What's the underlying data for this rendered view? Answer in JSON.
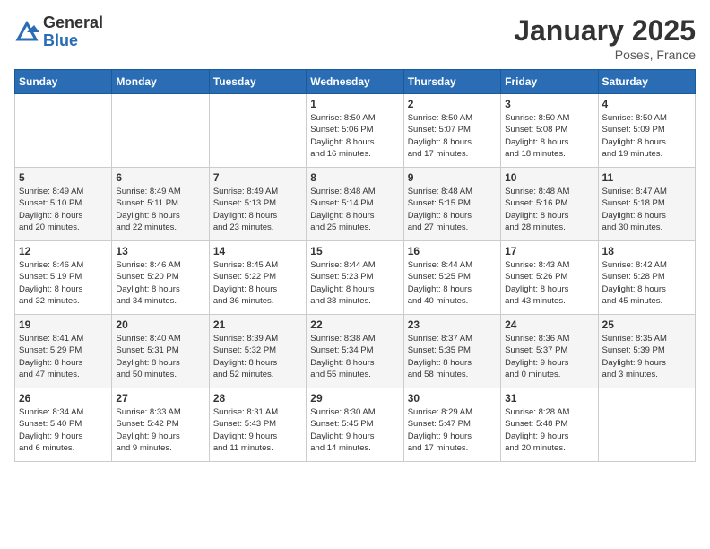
{
  "header": {
    "logo_general": "General",
    "logo_blue": "Blue",
    "month_title": "January 2025",
    "location": "Poses, France"
  },
  "days_of_week": [
    "Sunday",
    "Monday",
    "Tuesday",
    "Wednesday",
    "Thursday",
    "Friday",
    "Saturday"
  ],
  "weeks": [
    [
      {
        "day": "",
        "content": ""
      },
      {
        "day": "",
        "content": ""
      },
      {
        "day": "",
        "content": ""
      },
      {
        "day": "1",
        "content": "Sunrise: 8:50 AM\nSunset: 5:06 PM\nDaylight: 8 hours\nand 16 minutes."
      },
      {
        "day": "2",
        "content": "Sunrise: 8:50 AM\nSunset: 5:07 PM\nDaylight: 8 hours\nand 17 minutes."
      },
      {
        "day": "3",
        "content": "Sunrise: 8:50 AM\nSunset: 5:08 PM\nDaylight: 8 hours\nand 18 minutes."
      },
      {
        "day": "4",
        "content": "Sunrise: 8:50 AM\nSunset: 5:09 PM\nDaylight: 8 hours\nand 19 minutes."
      }
    ],
    [
      {
        "day": "5",
        "content": "Sunrise: 8:49 AM\nSunset: 5:10 PM\nDaylight: 8 hours\nand 20 minutes."
      },
      {
        "day": "6",
        "content": "Sunrise: 8:49 AM\nSunset: 5:11 PM\nDaylight: 8 hours\nand 22 minutes."
      },
      {
        "day": "7",
        "content": "Sunrise: 8:49 AM\nSunset: 5:13 PM\nDaylight: 8 hours\nand 23 minutes."
      },
      {
        "day": "8",
        "content": "Sunrise: 8:48 AM\nSunset: 5:14 PM\nDaylight: 8 hours\nand 25 minutes."
      },
      {
        "day": "9",
        "content": "Sunrise: 8:48 AM\nSunset: 5:15 PM\nDaylight: 8 hours\nand 27 minutes."
      },
      {
        "day": "10",
        "content": "Sunrise: 8:48 AM\nSunset: 5:16 PM\nDaylight: 8 hours\nand 28 minutes."
      },
      {
        "day": "11",
        "content": "Sunrise: 8:47 AM\nSunset: 5:18 PM\nDaylight: 8 hours\nand 30 minutes."
      }
    ],
    [
      {
        "day": "12",
        "content": "Sunrise: 8:46 AM\nSunset: 5:19 PM\nDaylight: 8 hours\nand 32 minutes."
      },
      {
        "day": "13",
        "content": "Sunrise: 8:46 AM\nSunset: 5:20 PM\nDaylight: 8 hours\nand 34 minutes."
      },
      {
        "day": "14",
        "content": "Sunrise: 8:45 AM\nSunset: 5:22 PM\nDaylight: 8 hours\nand 36 minutes."
      },
      {
        "day": "15",
        "content": "Sunrise: 8:44 AM\nSunset: 5:23 PM\nDaylight: 8 hours\nand 38 minutes."
      },
      {
        "day": "16",
        "content": "Sunrise: 8:44 AM\nSunset: 5:25 PM\nDaylight: 8 hours\nand 40 minutes."
      },
      {
        "day": "17",
        "content": "Sunrise: 8:43 AM\nSunset: 5:26 PM\nDaylight: 8 hours\nand 43 minutes."
      },
      {
        "day": "18",
        "content": "Sunrise: 8:42 AM\nSunset: 5:28 PM\nDaylight: 8 hours\nand 45 minutes."
      }
    ],
    [
      {
        "day": "19",
        "content": "Sunrise: 8:41 AM\nSunset: 5:29 PM\nDaylight: 8 hours\nand 47 minutes."
      },
      {
        "day": "20",
        "content": "Sunrise: 8:40 AM\nSunset: 5:31 PM\nDaylight: 8 hours\nand 50 minutes."
      },
      {
        "day": "21",
        "content": "Sunrise: 8:39 AM\nSunset: 5:32 PM\nDaylight: 8 hours\nand 52 minutes."
      },
      {
        "day": "22",
        "content": "Sunrise: 8:38 AM\nSunset: 5:34 PM\nDaylight: 8 hours\nand 55 minutes."
      },
      {
        "day": "23",
        "content": "Sunrise: 8:37 AM\nSunset: 5:35 PM\nDaylight: 8 hours\nand 58 minutes."
      },
      {
        "day": "24",
        "content": "Sunrise: 8:36 AM\nSunset: 5:37 PM\nDaylight: 9 hours\nand 0 minutes."
      },
      {
        "day": "25",
        "content": "Sunrise: 8:35 AM\nSunset: 5:39 PM\nDaylight: 9 hours\nand 3 minutes."
      }
    ],
    [
      {
        "day": "26",
        "content": "Sunrise: 8:34 AM\nSunset: 5:40 PM\nDaylight: 9 hours\nand 6 minutes."
      },
      {
        "day": "27",
        "content": "Sunrise: 8:33 AM\nSunset: 5:42 PM\nDaylight: 9 hours\nand 9 minutes."
      },
      {
        "day": "28",
        "content": "Sunrise: 8:31 AM\nSunset: 5:43 PM\nDaylight: 9 hours\nand 11 minutes."
      },
      {
        "day": "29",
        "content": "Sunrise: 8:30 AM\nSunset: 5:45 PM\nDaylight: 9 hours\nand 14 minutes."
      },
      {
        "day": "30",
        "content": "Sunrise: 8:29 AM\nSunset: 5:47 PM\nDaylight: 9 hours\nand 17 minutes."
      },
      {
        "day": "31",
        "content": "Sunrise: 8:28 AM\nSunset: 5:48 PM\nDaylight: 9 hours\nand 20 minutes."
      },
      {
        "day": "",
        "content": ""
      }
    ]
  ]
}
